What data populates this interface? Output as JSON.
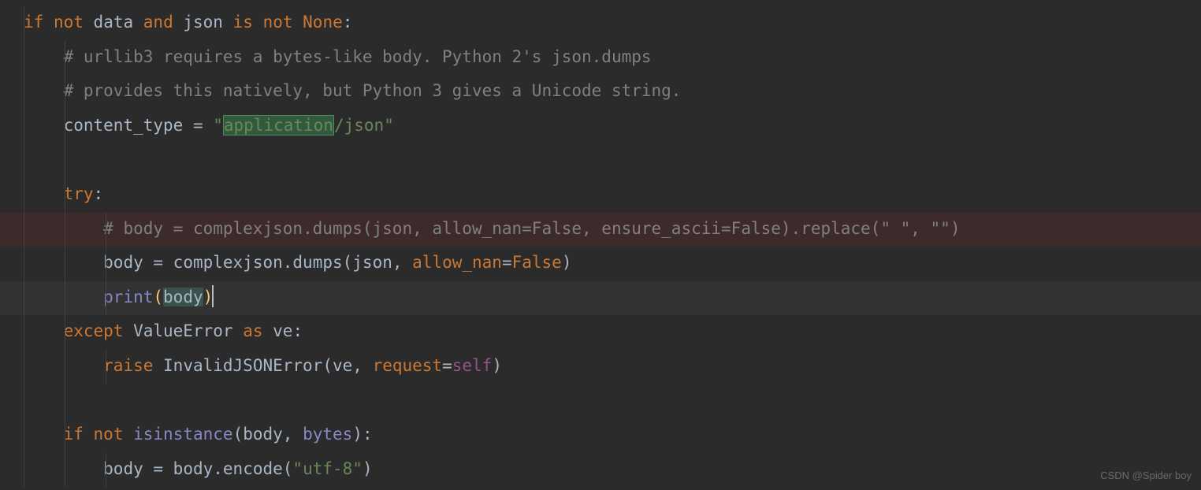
{
  "watermark": "CSDN @Spider boy",
  "code": {
    "line1": {
      "if": "if",
      "not1": "not",
      "data": "data",
      "and": "and",
      "json": "json",
      "is": "is",
      "not2": "not",
      "none": "None",
      "colon": ":"
    },
    "line2": "# urllib3 requires a bytes-like body. Python 2's json.dumps",
    "line3": "# provides this natively, but Python 3 gives a Unicode string.",
    "line4": {
      "var": "content_type",
      "eq": " = ",
      "q1": "\"",
      "hl": "application",
      "rest": "/json",
      "q2": "\""
    },
    "line6": {
      "try": "try",
      "colon": ":"
    },
    "line7": "# body = complexjson.dumps(json, allow_nan=False, ensure_ascii=False).replace(\" \", \"\")",
    "line8": {
      "body": "body",
      "eq": " = ",
      "cj": "complexjson",
      "dot": ".",
      "dumps": "dumps",
      "lp": "(",
      "json": "json",
      "comma": ", ",
      "an": "allow_nan",
      "eq2": "=",
      "false": "False",
      "rp": ")"
    },
    "line9": {
      "print": "print",
      "lp": "(",
      "body": "body",
      "rp": ")"
    },
    "line10": {
      "except": "except",
      "err": "ValueError",
      "as": "as",
      "ve": "ve",
      "colon": ":"
    },
    "line11": {
      "raise": "raise",
      "err": "InvalidJSONError",
      "lp": "(",
      "ve": "ve",
      "comma": ", ",
      "req": "request",
      "eq": "=",
      "self": "self",
      "rp": ")"
    },
    "line13": {
      "if": "if",
      "not": "not",
      "isi": "isinstance",
      "lp": "(",
      "body": "body",
      "comma": ", ",
      "bytes": "bytes",
      "rp": ")",
      "colon": ":"
    },
    "line14": {
      "body": "body",
      "eq": " = ",
      "body2": "body",
      "dot": ".",
      "enc": "encode",
      "lp": "(",
      "utf": "\"utf-8\"",
      "rp": ")"
    }
  }
}
